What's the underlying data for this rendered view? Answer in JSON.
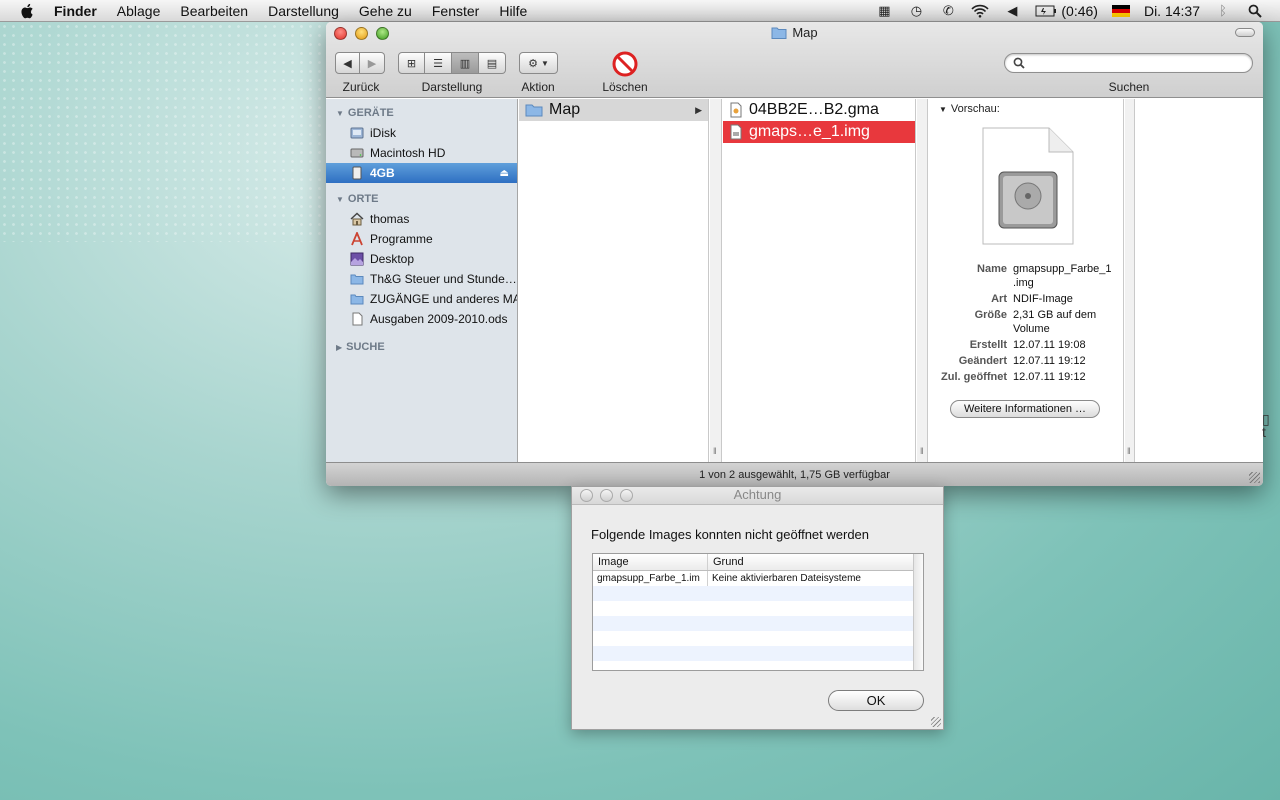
{
  "menubar": {
    "app": "Finder",
    "items": [
      "Ablage",
      "Bearbeiten",
      "Darstellung",
      "Gehe zu",
      "Fenster",
      "Hilfe"
    ],
    "battery": "(0:46)",
    "clock": "Di. 14:37"
  },
  "finder": {
    "title": "Map",
    "toolbar": {
      "back_label": "Zurück",
      "view_label": "Darstellung",
      "action_label": "Aktion",
      "delete_label": "Löschen",
      "search_label": "Suchen",
      "search_placeholder": ""
    },
    "sidebar": {
      "devices_header": "GERÄTE",
      "devices": [
        {
          "label": "iDisk",
          "icon": "idisk-icon"
        },
        {
          "label": "Macintosh HD",
          "icon": "hard-disk-icon"
        },
        {
          "label": "4GB",
          "icon": "usb-drive-icon",
          "selected": true
        }
      ],
      "places_header": "ORTE",
      "places": [
        {
          "label": "thomas",
          "icon": "home-icon"
        },
        {
          "label": "Programme",
          "icon": "applications-icon"
        },
        {
          "label": "Desktop",
          "icon": "desktop-icon"
        },
        {
          "label": "Th&G Steuer und Stunde…",
          "icon": "folder-icon"
        },
        {
          "label": "ZUGÄNGE und anderes MAC",
          "icon": "folder-icon"
        },
        {
          "label": "Ausgaben 2009-2010.ods",
          "icon": "document-icon"
        }
      ],
      "search_header": "SUCHE"
    },
    "column1": [
      {
        "label": "Map",
        "icon": "folder-icon"
      }
    ],
    "column2": [
      {
        "label": "04BB2E…B2.gma",
        "icon": "file-icon"
      },
      {
        "label": "gmaps…e_1.img",
        "icon": "disk-image-icon",
        "selected": true
      }
    ],
    "preview": {
      "header": "Vorschau:",
      "fields": [
        {
          "key": "Name",
          "value": "gmapsupp_Farbe_1 .img"
        },
        {
          "key": "Art",
          "value": "NDIF-Image"
        },
        {
          "key": "Größe",
          "value": "2,31 GB auf dem Volume"
        },
        {
          "key": "Erstellt",
          "value": "12.07.11 19:08"
        },
        {
          "key": "Geändert",
          "value": "12.07.11 19:12"
        },
        {
          "key": "Zul. geöffnet",
          "value": "12.07.11 19:12"
        }
      ],
      "more_button": "Weitere Informationen …"
    },
    "status": "1 von 2 ausgewählt, 1,75 GB verfügbar"
  },
  "dialog": {
    "title": "Achtung",
    "message": "Folgende Images konnten nicht geöffnet werden",
    "columns": [
      "Image",
      "Grund"
    ],
    "rows": [
      [
        "gmapsupp_Farbe_1.im",
        "Keine aktivierbaren Dateisysteme"
      ]
    ],
    "ok_label": "OK"
  },
  "colors": {
    "selection_blue": "#2e6fc2",
    "selection_red": "#e8383d",
    "sidebar_bg": "#dee4ea"
  }
}
